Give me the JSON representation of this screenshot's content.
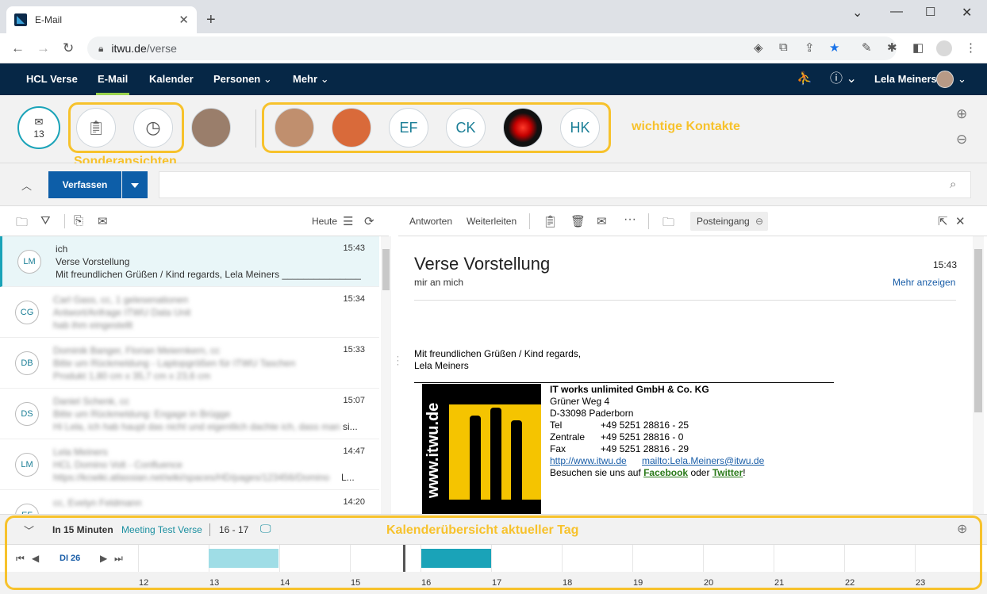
{
  "browser": {
    "tab_title": "E-Mail",
    "url_host": "itwu.de",
    "url_path": "/verse"
  },
  "app": {
    "menu": [
      {
        "label": "HCL Verse"
      },
      {
        "label": "E-Mail"
      },
      {
        "label": "Kalender"
      },
      {
        "label": "Personen"
      },
      {
        "label": "Mehr"
      }
    ],
    "user_name": "Lela Meiners"
  },
  "contacts_bar": {
    "inbox_count": "13",
    "special_views_label": "Sonderansichten",
    "important_contacts_label": "wichtige Kontakte",
    "contact_initials": [
      "EF",
      "CK",
      "HK"
    ]
  },
  "compose": {
    "label": "Verfassen"
  },
  "list_toolbar": {
    "date_label": "Heute"
  },
  "messages": [
    {
      "initials": "LM",
      "sender": "ich",
      "subject": "Verse Vorstellung",
      "preview": "Mit freundlichen Grüßen / Kind regards, Lela Meiners ________________...",
      "time": "15:43",
      "selected": true
    },
    {
      "initials": "CG",
      "sender": "Carl Gass, cc, 1 gelesenationen",
      "subject": "Antwort/Anfrage ITWU Data Unit",
      "preview": "hab ihm eingestellt",
      "time": "15:34",
      "selected": false
    },
    {
      "initials": "DB",
      "sender": "Dominik Banger, Florian Meiernkern, cc",
      "subject": "Bitte um Rückmeldung - Laptopgrößen für ITWU Taschen",
      "preview": "Produkt 1,80 cm x 35,7 cm x 23,6 cm",
      "time": "15:33",
      "selected": false
    },
    {
      "initials": "DS",
      "sender": "Daniel Schenk, cc",
      "subject": "Bitte um Rückmeldung: Engage in Brügge",
      "preview": "Hi Lela, ich hab haupt das nicht und eigentlich dachte ich, dass man",
      "preview_tail": "si...",
      "time": "15:07",
      "selected": false
    },
    {
      "initials": "LM",
      "sender": "Lela Meiners",
      "subject": "HCL Domino Volt - Confluence",
      "preview": "https://kcwiki.atlassian.net/wiki/spaces/HD/pages/123456/Domino",
      "preview_tail": "L...",
      "time": "14:47",
      "selected": false
    },
    {
      "initials": "EF",
      "sender": "cc, Evelyn Feldmann",
      "subject": "",
      "preview": "",
      "time": "14:20",
      "selected": false
    }
  ],
  "reader_toolbar": {
    "reply": "Antworten",
    "forward": "Weiterleiten",
    "folder": "Posteingang"
  },
  "email": {
    "subject": "Verse Vorstellung",
    "time": "15:43",
    "recipients": "mir an mich",
    "show_more": "Mehr anzeigen",
    "greeting": "Mit freundlichen Grüßen / Kind regards,",
    "name": "Lela Meiners",
    "logo_text": "www.itwu.de",
    "company": "IT works unlimited GmbH & Co. KG",
    "street": "Grüner Weg 4",
    "city": "D-33098 Paderborn",
    "tel_label": "Tel",
    "tel": "+49 5251 28816 - 25",
    "central_label": "Zentrale",
    "central": "+49 5251 28816 - 0",
    "fax_label": "Fax",
    "fax": "+49 5251 28816 - 29",
    "web_link": "http://www.itwu.de",
    "mail_link": "mailto:Lela.Meiners@itwu.de",
    "visit_prefix": "Besuchen sie uns auf",
    "facebook": "Facebook",
    "visit_mid": "oder",
    "twitter": "Twitter",
    "visit_suffix": "!"
  },
  "calendar": {
    "upcoming_prefix": "In 15 Minuten",
    "event_title": "Meeting Test Verse",
    "event_time": "16 - 17",
    "overview_label": "Kalenderübersicht aktueller Tag",
    "day_label": "DI 26",
    "hours": [
      "12",
      "13",
      "14",
      "15",
      "16",
      "17",
      "18",
      "19",
      "20",
      "21",
      "22",
      "23"
    ]
  },
  "colors": {
    "header_bg": "#062746",
    "accent": "#1aa3b8",
    "highlight": "#f7c22c",
    "compose_bg": "#0d5ea8"
  }
}
